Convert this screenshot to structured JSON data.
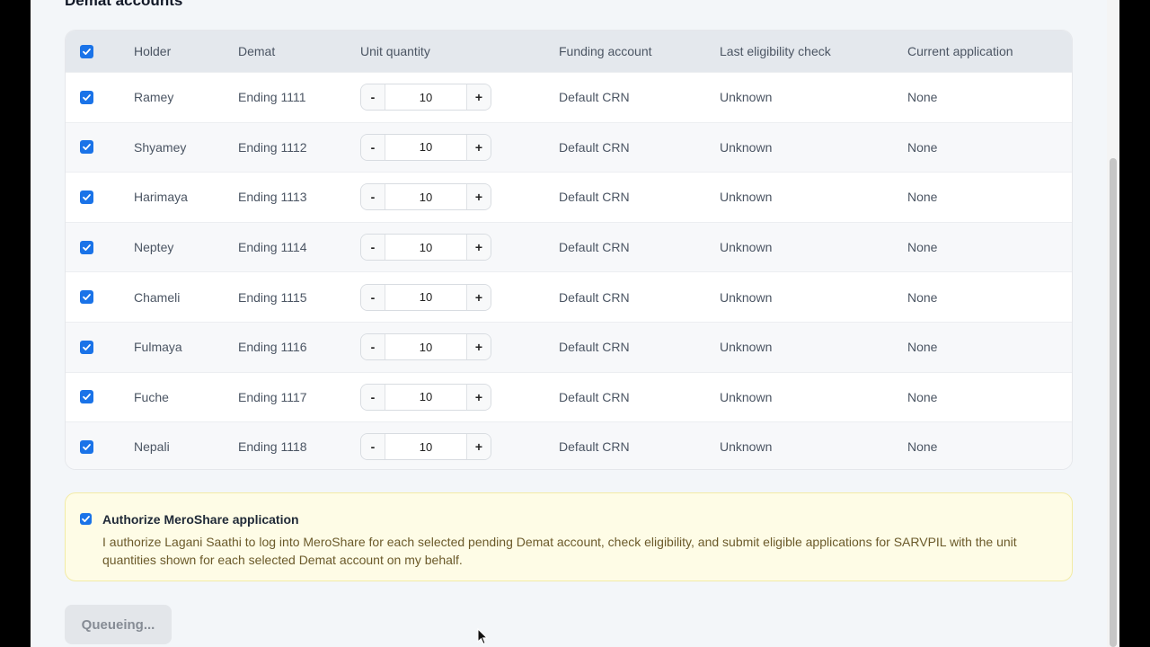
{
  "section": {
    "title": "Demat accounts"
  },
  "table": {
    "headers": {
      "holder": "Holder",
      "demat": "Demat",
      "unit_quantity": "Unit quantity",
      "funding_account": "Funding account",
      "last_eligibility_check": "Last eligibility check",
      "current_application": "Current application"
    },
    "select_all_checked": true,
    "decrement_label": "-",
    "increment_label": "+",
    "rows": [
      {
        "holder": "Ramey",
        "demat": "Ending 1111",
        "qty": "10",
        "funding": "Default CRN",
        "eligibility": "Unknown",
        "application": "None",
        "checked": true
      },
      {
        "holder": "Shyamey",
        "demat": "Ending 1112",
        "qty": "10",
        "funding": "Default CRN",
        "eligibility": "Unknown",
        "application": "None",
        "checked": true
      },
      {
        "holder": "Harimaya",
        "demat": "Ending 1113",
        "qty": "10",
        "funding": "Default CRN",
        "eligibility": "Unknown",
        "application": "None",
        "checked": true
      },
      {
        "holder": "Neptey",
        "demat": "Ending 1114",
        "qty": "10",
        "funding": "Default CRN",
        "eligibility": "Unknown",
        "application": "None",
        "checked": true
      },
      {
        "holder": "Chameli",
        "demat": "Ending 1115",
        "qty": "10",
        "funding": "Default CRN",
        "eligibility": "Unknown",
        "application": "None",
        "checked": true
      },
      {
        "holder": "Fulmaya",
        "demat": "Ending 1116",
        "qty": "10",
        "funding": "Default CRN",
        "eligibility": "Unknown",
        "application": "None",
        "checked": true
      },
      {
        "holder": "Fuche",
        "demat": "Ending 1117",
        "qty": "10",
        "funding": "Default CRN",
        "eligibility": "Unknown",
        "application": "None",
        "checked": true
      },
      {
        "holder": "Nepali",
        "demat": "Ending 1118",
        "qty": "10",
        "funding": "Default CRN",
        "eligibility": "Unknown",
        "application": "None",
        "checked": true
      }
    ]
  },
  "authorization": {
    "checked": true,
    "title": "Authorize MeroShare application",
    "text": "I authorize Lagani Saathi to log into MeroShare for each selected pending Demat account, check eligibility, and submit eligible applications for SARVPIL with the unit quantities shown for each selected Demat account on my behalf."
  },
  "submit_button": {
    "label": "Queueing..."
  },
  "colors": {
    "accent": "#1a73e8",
    "auth_background": "#fefce6",
    "button_disabled": "#e3e6ea"
  },
  "icons": {
    "checkbox": "checkmark-icon",
    "cursor": "mouse-pointer-icon"
  }
}
